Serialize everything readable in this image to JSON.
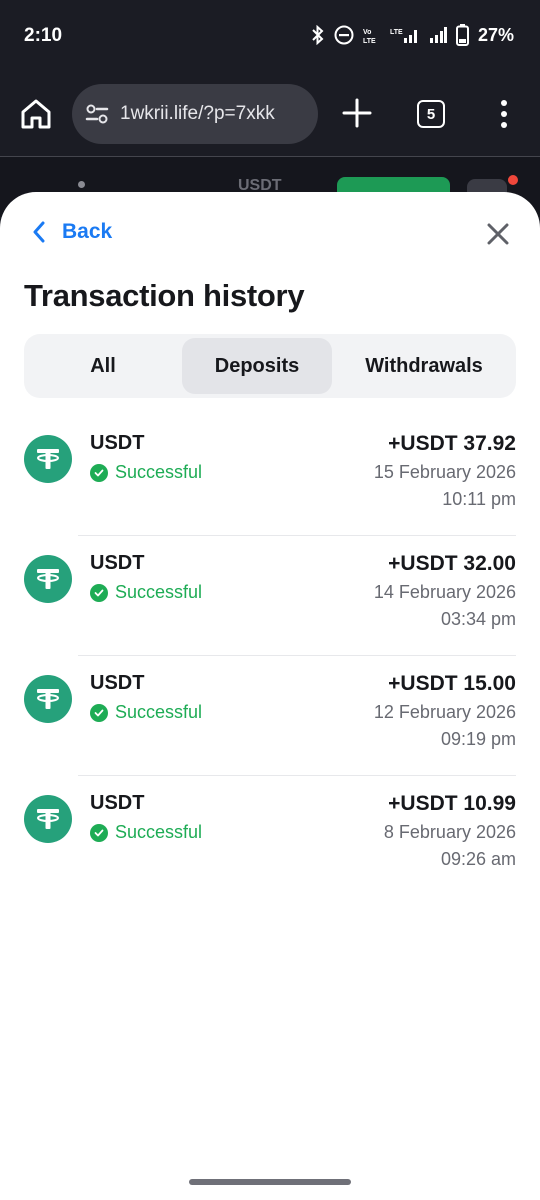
{
  "status_bar": {
    "time": "2:10",
    "battery": "27%",
    "icons": [
      "bluetooth-icon",
      "dnd-icon",
      "volte-icon",
      "lte-signal-icon",
      "signal-icon",
      "battery-icon"
    ]
  },
  "browser": {
    "url": "1wkrii.life/?p=7xkk",
    "tab_count": "5"
  },
  "background_page": {
    "currency": "USDT"
  },
  "sheet": {
    "back_label": "Back",
    "title": "Transaction history",
    "tabs": [
      {
        "label": "All",
        "selected": false
      },
      {
        "label": "Deposits",
        "selected": true
      },
      {
        "label": "Withdrawals",
        "selected": false
      }
    ],
    "transactions": [
      {
        "name": "USDT",
        "status": "Successful",
        "amount": "+USDT 37.92",
        "date": "15 February 2026",
        "time": "10:11 pm"
      },
      {
        "name": "USDT",
        "status": "Successful",
        "amount": "+USDT 32.00",
        "date": "14 February 2026",
        "time": "03:34 pm"
      },
      {
        "name": "USDT",
        "status": "Successful",
        "amount": "+USDT 15.00",
        "date": "12 February 2026",
        "time": "09:19 pm"
      },
      {
        "name": "USDT",
        "status": "Successful",
        "amount": "+USDT 10.99",
        "date": "8 February 2026",
        "time": "09:26 am"
      }
    ]
  },
  "colors": {
    "accent_blue": "#1a7af3",
    "success_green": "#1eac55",
    "tether_green": "#26a17b",
    "browser_dark": "#1b1c24"
  }
}
